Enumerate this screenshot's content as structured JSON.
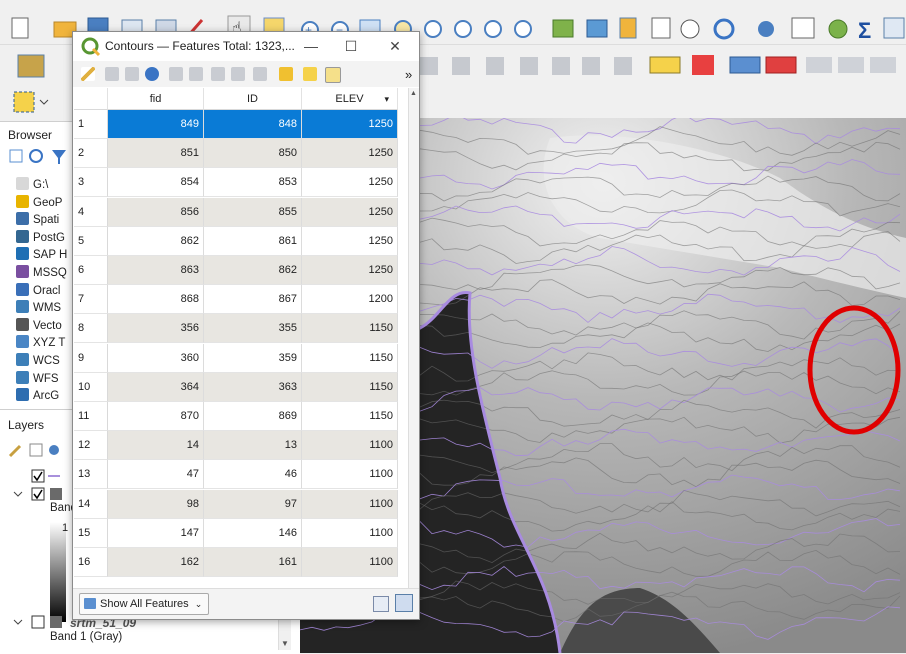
{
  "attribute_window": {
    "title": "Contours — Features Total: 1323,...",
    "min_symbol": "—",
    "max_symbol": "☐",
    "close_symbol": "✕",
    "more_symbol": "»",
    "columns": [
      "fid",
      "ID",
      "ELEV"
    ],
    "sort_indicator": "▾",
    "rows": [
      {
        "n": "1",
        "fid": "849",
        "id": "848",
        "elev": "1250"
      },
      {
        "n": "2",
        "fid": "851",
        "id": "850",
        "elev": "1250"
      },
      {
        "n": "3",
        "fid": "854",
        "id": "853",
        "elev": "1250"
      },
      {
        "n": "4",
        "fid": "856",
        "id": "855",
        "elev": "1250"
      },
      {
        "n": "5",
        "fid": "862",
        "id": "861",
        "elev": "1250"
      },
      {
        "n": "6",
        "fid": "863",
        "id": "862",
        "elev": "1250"
      },
      {
        "n": "7",
        "fid": "868",
        "id": "867",
        "elev": "1200"
      },
      {
        "n": "8",
        "fid": "356",
        "id": "355",
        "elev": "1150"
      },
      {
        "n": "9",
        "fid": "360",
        "id": "359",
        "elev": "1150"
      },
      {
        "n": "10",
        "fid": "364",
        "id": "363",
        "elev": "1150"
      },
      {
        "n": "11",
        "fid": "870",
        "id": "869",
        "elev": "1150"
      },
      {
        "n": "12",
        "fid": "14",
        "id": "13",
        "elev": "1100"
      },
      {
        "n": "13",
        "fid": "47",
        "id": "46",
        "elev": "1100"
      },
      {
        "n": "14",
        "fid": "98",
        "id": "97",
        "elev": "1100"
      },
      {
        "n": "15",
        "fid": "147",
        "id": "146",
        "elev": "1100"
      },
      {
        "n": "16",
        "fid": "162",
        "id": "161",
        "elev": "1100"
      }
    ],
    "show_all_label": "Show All Features"
  },
  "browser": {
    "title": "Browser",
    "items": [
      {
        "label": "G:\\",
        "color": "#d8d8d8"
      },
      {
        "label": "GeoP",
        "color": "#e8b400"
      },
      {
        "label": "Spati",
        "color": "#3c6ea8"
      },
      {
        "label": "PostG",
        "color": "#336791"
      },
      {
        "label": "SAP H",
        "color": "#1f6fb4"
      },
      {
        "label": "MSSQ",
        "color": "#7a4fa0"
      },
      {
        "label": "Oracl",
        "color": "#3a6fb8"
      },
      {
        "label": "WMS",
        "color": "#3d7fb8"
      },
      {
        "label": "Vecto",
        "color": "#555555"
      },
      {
        "label": "XYZ T",
        "color": "#4a86c5"
      },
      {
        "label": "WCS",
        "color": "#3d7fb8"
      },
      {
        "label": "WFS",
        "color": "#3d7fb8"
      },
      {
        "label": "ArcG",
        "color": "#2e6db0"
      }
    ]
  },
  "layers": {
    "title": "Layers",
    "band_label": "Band",
    "legend_tick": "1",
    "raster_name": "srtm_51_09",
    "band_gray": "Band 1 (Gray)"
  },
  "colors": {
    "selection": "#0a7bd6",
    "alt_row": "#e8e6e1",
    "contour": "#a88be0",
    "highlight_circle": "#e00000"
  }
}
